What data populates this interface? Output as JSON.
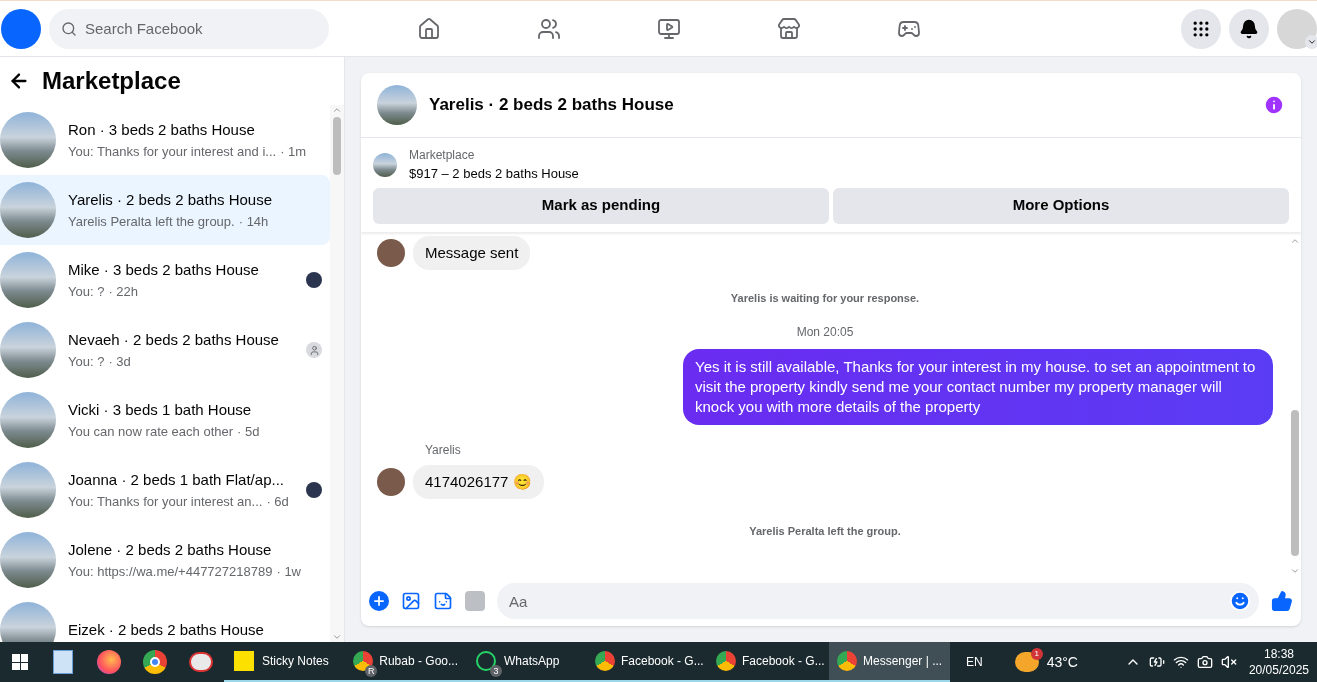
{
  "topbar": {
    "search": {
      "placeholder": "Search Facebook"
    },
    "nav": [
      {
        "kind": "home"
      },
      {
        "kind": "friends"
      },
      {
        "kind": "video"
      },
      {
        "kind": "marketplace"
      },
      {
        "kind": "gaming"
      }
    ]
  },
  "sidebar": {
    "title": "Marketplace",
    "conversations": [
      {
        "name": "Ron · 3 beds 2 baths House",
        "preview": "You: Thanks for your interest and i...",
        "time": "· 1m",
        "selected": false,
        "kind": "plain"
      },
      {
        "name": "Yarelis · 2 beds 2 baths House",
        "preview": "Yarelis Peralta left the group.",
        "time": "· 14h",
        "selected": true,
        "kind": "plain"
      },
      {
        "name": "Mike · 3 beds 2 baths House",
        "preview": "You: ?",
        "time": "· 22h",
        "selected": false,
        "kind": "seen-photo"
      },
      {
        "name": "Nevaeh · 2 beds 2 baths House",
        "preview": "You: ?",
        "time": "· 3d",
        "selected": false,
        "kind": "seen-default"
      },
      {
        "name": "Vicki · 3 beds 1 bath House",
        "preview": "You can now rate each other",
        "time": "· 5d",
        "selected": false,
        "kind": "plain"
      },
      {
        "name": "Joanna · 2 beds 1 bath Flat/ap...",
        "preview": "You: Thanks for your interest an...",
        "time": "· 6d",
        "selected": false,
        "kind": "seen-photo"
      },
      {
        "name": "Jolene · 2 beds 2 baths House",
        "preview": "You: https://wa.me/+447727218789",
        "time": "· 1w",
        "selected": false,
        "kind": "plain"
      },
      {
        "name": "Eizek · 2 beds 2 baths House",
        "selected": false,
        "kind": "plain"
      }
    ]
  },
  "chat": {
    "title": "Yarelis · 2 beds 2 baths House",
    "listing": {
      "label": "Marketplace",
      "detail": "$917 – 2 beds 2 baths House"
    },
    "actions": [
      "Mark as pending",
      "More Options"
    ],
    "messages": [
      {
        "kind": "incoming",
        "text": "Message sent"
      },
      {
        "kind": "status",
        "text": "Yarelis is waiting for your response."
      },
      {
        "kind": "timestamp",
        "text": "Mon 20:05"
      },
      {
        "kind": "outgoing",
        "text": "Yes it is still available, Thanks for your interest in my house. to set an appointment to visit the property kindly send me your contact number my property manager will knock you with more details of the property"
      },
      {
        "kind": "sender",
        "text": "Yarelis"
      },
      {
        "kind": "incoming",
        "text": "4174026177 😊"
      },
      {
        "kind": "status",
        "text": "Yarelis Peralta left the group."
      }
    ],
    "composer": {
      "placeholder": "Aa"
    }
  },
  "taskbar": {
    "pinned": [
      {
        "kind": "files"
      },
      {
        "kind": "firefox"
      },
      {
        "kind": "chrome"
      },
      {
        "kind": "snip"
      }
    ],
    "apps": [
      {
        "kind": "notes",
        "label": "Sticky Notes",
        "active": false
      },
      {
        "kind": "chrome",
        "label": "Rubab - Goo...",
        "badge": "R",
        "active": false
      },
      {
        "kind": "whatsapp",
        "label": "WhatsApp",
        "badge": "3",
        "active": false
      },
      {
        "kind": "chrome",
        "label": "Facebook - G...",
        "active": false
      },
      {
        "kind": "chrome",
        "label": "Facebook - G...",
        "active": false
      },
      {
        "kind": "chrome",
        "label": "Messenger | ...",
        "active": true
      }
    ],
    "language": "EN",
    "weather": {
      "badge": "1",
      "temp": "43°C"
    },
    "time": "18:38",
    "date": "20/05/2025"
  }
}
